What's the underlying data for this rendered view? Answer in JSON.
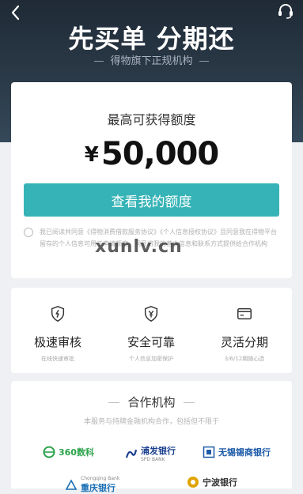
{
  "header": {
    "title": "先买单 分期还",
    "subtitle": "得物旗下正规机构"
  },
  "quota": {
    "label": "最高可获得额度",
    "currency": "¥",
    "amount": "50,000",
    "button_label": "查看我的额度"
  },
  "agreement": {
    "text": "我已阅读并同意《得物消费借款服务协议》《个人信息授权协议》且同意我在得物平台留存的个人信息可用于申请额度，同意将我的基本信息和联系方式提供给合作机构"
  },
  "features": [
    {
      "title": "极速审核",
      "subtitle": "在线快速审批",
      "icon": "lightning-shield-icon"
    },
    {
      "title": "安全可靠",
      "subtitle": "个人信息加密保护",
      "icon": "yen-shield-icon"
    },
    {
      "title": "灵活分期",
      "subtitle": "3/6/12期随心选",
      "icon": "card-icon"
    }
  ],
  "partners": {
    "title": "合作机构",
    "subtitle": "本服务与持牌金融机构合作，包括但不限于",
    "logos": [
      {
        "name": "360数科",
        "icon": "360-logo-icon",
        "color": "#2aa34a"
      },
      {
        "name": "浦发银行",
        "sub": "SPD BANK",
        "icon": "spd-bank-logo-icon",
        "color": "#1b3f8f"
      },
      {
        "name": "无锡锡商银行",
        "icon": "xishang-bank-logo-icon",
        "color": "#1b5aa8"
      },
      {
        "name": "重庆银行",
        "sub": "Chongqing Bank",
        "icon": "chongqing-bank-logo-icon",
        "color": "#1a6fb4"
      },
      {
        "name": "宁波银行",
        "icon": "ningbo-bank-logo-icon",
        "color": "#e0a300"
      }
    ]
  },
  "watermark": "xunlv.cn",
  "colors": {
    "accent": "#36b3b6",
    "hero_bg": "#26323f"
  }
}
